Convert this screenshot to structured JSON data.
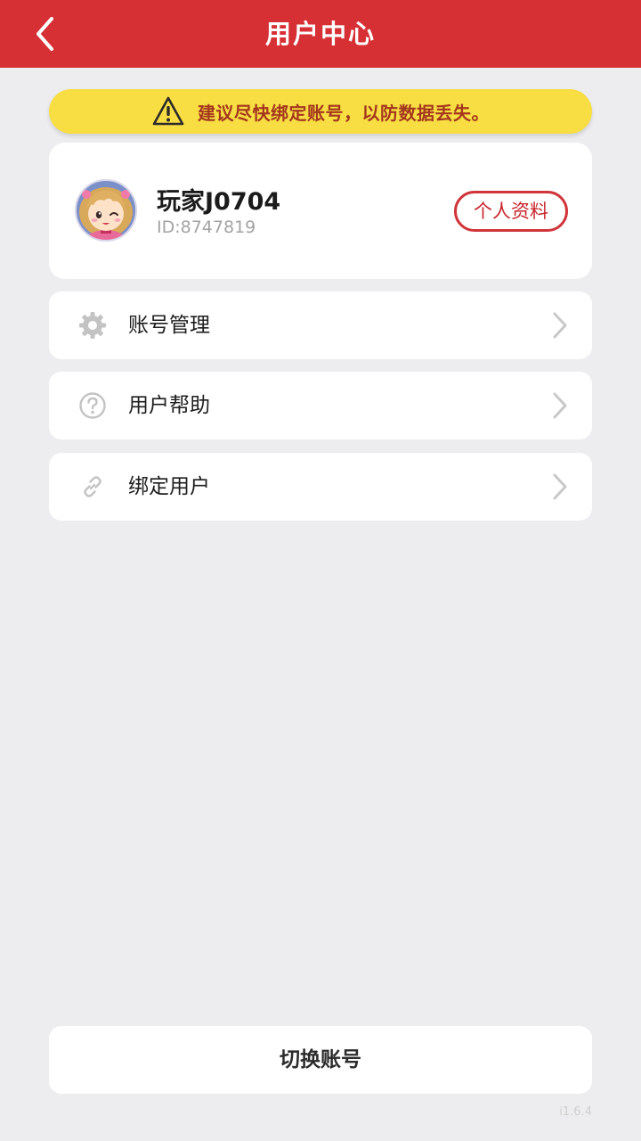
{
  "header": {
    "title": "用户中心",
    "back_icon": "chevron-left-icon",
    "color": "#d63035"
  },
  "notice": {
    "icon": "warning-icon",
    "text": "建议尽快绑定账号，以防数据丢失。",
    "background": "#f8dd43"
  },
  "profile": {
    "name": "玩家J0704",
    "id_text": "ID:8747819",
    "avatar": "cartoon-girl-avatar",
    "button_label": "个人资料"
  },
  "menu": [
    {
      "label": "账号管理",
      "icon": "gear-icon"
    },
    {
      "label": "用户帮助",
      "icon": "question-circle-icon"
    },
    {
      "label": "绑定用户",
      "icon": "link-icon"
    }
  ],
  "footer": {
    "switch_label": "切换账号",
    "version": "i1.6.4"
  }
}
